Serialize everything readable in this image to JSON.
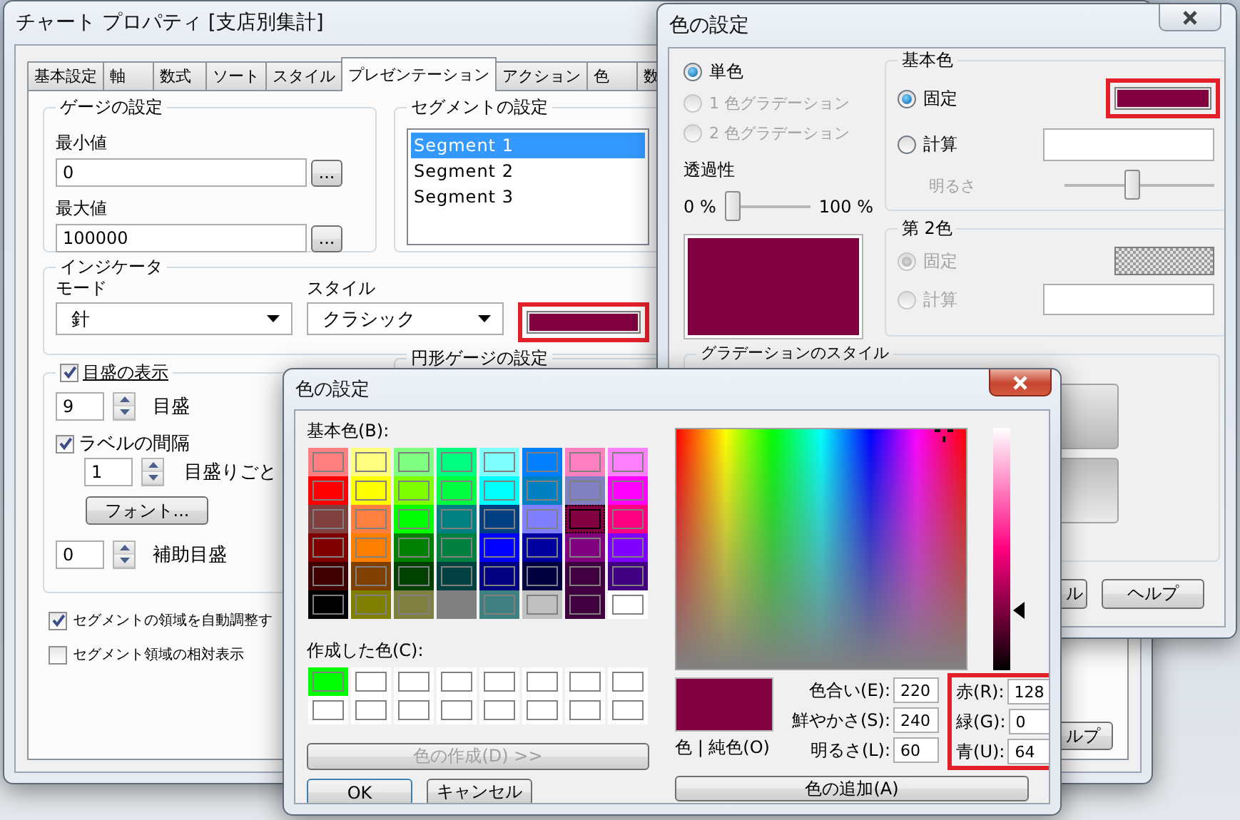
{
  "chart_properties": {
    "title": "チャート プロパティ [支店別集計]",
    "tabs": [
      {
        "label": "基本設定",
        "selected": false
      },
      {
        "label": "軸",
        "selected": false
      },
      {
        "label": "数式",
        "selected": false
      },
      {
        "label": "ソート",
        "selected": false
      },
      {
        "label": "スタイル",
        "selected": false
      },
      {
        "label": "プレゼンテーション",
        "selected": true
      },
      {
        "label": "アクション",
        "selected": false
      },
      {
        "label": "色",
        "selected": false
      },
      {
        "label": "数",
        "selected": false
      }
    ],
    "gauge": {
      "heading": "ゲージの設定",
      "min_label": "最小値",
      "min_value": "0",
      "max_label": "最大値",
      "max_value": "100000",
      "browse_button": "..."
    },
    "segments": {
      "heading": "セグメントの設定",
      "items": [
        {
          "label": "Segment 1",
          "selected": true
        },
        {
          "label": "Segment 2",
          "selected": false
        },
        {
          "label": "Segment 3",
          "selected": false
        }
      ]
    },
    "indicator": {
      "heading": "インジケータ",
      "mode_label": "モード",
      "mode_value": "針",
      "style_label": "スタイル",
      "style_value": "クラシック",
      "swatch": {
        "color": "#800040",
        "highlighted": true
      }
    },
    "ticks": {
      "heading": "目盛の表示",
      "checked": true,
      "count": "9",
      "count_label": "目盛",
      "interval_label": "ラベルの間隔",
      "interval_checked": true,
      "interval_value": "1",
      "interval_unit": "目盛りごと",
      "font_button": "フォント...",
      "minor_value": "0",
      "minor_label": "補助目盛"
    },
    "circular_heading": "円形ゲージの設定",
    "options": [
      {
        "label": "セグメントの領域を自動調整す",
        "checked": true
      },
      {
        "label": "セグメント領域の相対表示",
        "checked": false
      }
    ],
    "help_button": "ルプ"
  },
  "color_settings": {
    "title": "色の設定",
    "fill_modes": [
      {
        "label": "単色",
        "selected": true,
        "disabled": false
      },
      {
        "label": "1 色グラデーション",
        "selected": false,
        "disabled": true
      },
      {
        "label": "2 色グラデーション",
        "selected": false,
        "disabled": true
      }
    ],
    "transparency": {
      "label": "透過性",
      "min": "0 %",
      "max": "100 %",
      "level": 0
    },
    "preview": {
      "color": "#800040"
    },
    "base_color": {
      "heading": "基本色",
      "options": [
        {
          "kind": "swatch",
          "label": "固定",
          "selected": true
        },
        {
          "kind": "field",
          "label": "計算",
          "selected": false
        }
      ],
      "swatch": {
        "color": "#800040",
        "highlighted": true
      },
      "brightness": {
        "label": "明るさ",
        "disabled": true,
        "level": 0.45
      }
    },
    "second_color": {
      "heading": "第 2色",
      "disabled": true,
      "options": [
        {
          "kind": "pattern",
          "label": "固定",
          "selected": true
        },
        {
          "kind": "field",
          "label": "計算",
          "selected": false
        }
      ]
    },
    "gradient_style": {
      "heading": "グラデーションのスタイル"
    },
    "buttons": [
      "ル",
      "ヘルプ"
    ]
  },
  "color_dialog": {
    "title": "色の設定",
    "basic_label": "基本色(B):",
    "basic_colors": [
      {
        "color": "#ff8080",
        "selected": false
      },
      {
        "color": "#ffff80",
        "selected": false
      },
      {
        "color": "#80ff80",
        "selected": false
      },
      {
        "color": "#00ff80",
        "selected": false
      },
      {
        "color": "#80ffff",
        "selected": false
      },
      {
        "color": "#0080ff",
        "selected": false
      },
      {
        "color": "#ff80c0",
        "selected": false
      },
      {
        "color": "#ff80ff",
        "selected": false
      },
      {
        "color": "#ff0000",
        "selected": false
      },
      {
        "color": "#ffff00",
        "selected": false
      },
      {
        "color": "#80ff00",
        "selected": false
      },
      {
        "color": "#00ff40",
        "selected": false
      },
      {
        "color": "#00ffff",
        "selected": false
      },
      {
        "color": "#0080c0",
        "selected": false
      },
      {
        "color": "#8080c0",
        "selected": false
      },
      {
        "color": "#ff00ff",
        "selected": false
      },
      {
        "color": "#804040",
        "selected": false
      },
      {
        "color": "#ff8040",
        "selected": false
      },
      {
        "color": "#00ff00",
        "selected": false
      },
      {
        "color": "#008080",
        "selected": false
      },
      {
        "color": "#004080",
        "selected": false
      },
      {
        "color": "#8080ff",
        "selected": false
      },
      {
        "color": "#800040",
        "selected": true
      },
      {
        "color": "#ff0080",
        "selected": false
      },
      {
        "color": "#800000",
        "selected": false
      },
      {
        "color": "#ff8000",
        "selected": false
      },
      {
        "color": "#008000",
        "selected": false
      },
      {
        "color": "#008040",
        "selected": false
      },
      {
        "color": "#0000ff",
        "selected": false
      },
      {
        "color": "#0000a0",
        "selected": false
      },
      {
        "color": "#800080",
        "selected": false
      },
      {
        "color": "#8000ff",
        "selected": false
      },
      {
        "color": "#400000",
        "selected": false
      },
      {
        "color": "#804000",
        "selected": false
      },
      {
        "color": "#004000",
        "selected": false
      },
      {
        "color": "#004040",
        "selected": false
      },
      {
        "color": "#000080",
        "selected": false
      },
      {
        "color": "#000040",
        "selected": false
      },
      {
        "color": "#400040",
        "selected": false
      },
      {
        "color": "#400080",
        "selected": false
      },
      {
        "color": "#000000",
        "selected": false
      },
      {
        "color": "#808000",
        "selected": false
      },
      {
        "color": "#808040",
        "selected": false
      },
      {
        "color": "#808080",
        "selected": false
      },
      {
        "color": "#408080",
        "selected": false
      },
      {
        "color": "#c0c0c0",
        "selected": false
      },
      {
        "color": "#400040",
        "selected": false
      },
      {
        "color": "#ffffff",
        "selected": false
      }
    ],
    "custom_label": "作成した色(C):",
    "custom_colors": [
      {
        "color": "#00ff00"
      },
      {
        "color": "#ffffff"
      },
      {
        "color": "#ffffff"
      },
      {
        "color": "#ffffff"
      },
      {
        "color": "#ffffff"
      },
      {
        "color": "#ffffff"
      },
      {
        "color": "#ffffff"
      },
      {
        "color": "#ffffff"
      },
      {
        "color": "#ffffff"
      },
      {
        "color": "#ffffff"
      },
      {
        "color": "#ffffff"
      },
      {
        "color": "#ffffff"
      },
      {
        "color": "#ffffff"
      },
      {
        "color": "#ffffff"
      },
      {
        "color": "#ffffff"
      },
      {
        "color": "#ffffff"
      }
    ],
    "define_button": {
      "label": "色の作成(D) >>",
      "disabled": true
    },
    "ok_button": "OK",
    "cancel_button": "キャンセル",
    "luminance": {
      "level": 0.25
    },
    "preview": {
      "color": "#800040",
      "label": "色 | 純色(O)"
    },
    "hsl": [
      {
        "label": "色合い(E):",
        "value": "220"
      },
      {
        "label": "鮮やかさ(S):",
        "value": "240"
      },
      {
        "label": "明るさ(L):",
        "value": "60"
      }
    ],
    "rgb": {
      "highlighted": true,
      "fields": [
        {
          "label": "赤(R):",
          "value": "128"
        },
        {
          "label": "緑(G):",
          "value": "0"
        },
        {
          "label": "青(U):",
          "value": "64"
        }
      ]
    },
    "add_button": "色の追加(A)"
  }
}
